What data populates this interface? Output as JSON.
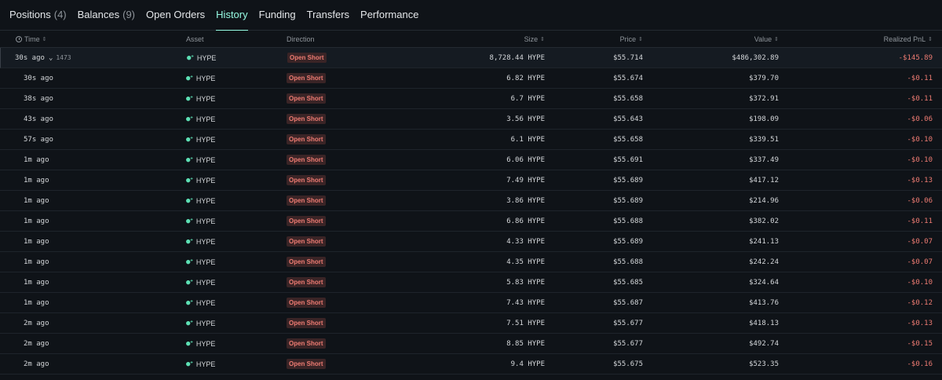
{
  "tabs": [
    {
      "label": "Positions",
      "count": "(4)"
    },
    {
      "label": "Balances",
      "count": "(9)"
    },
    {
      "label": "Open Orders",
      "count": ""
    },
    {
      "label": "History",
      "count": ""
    },
    {
      "label": "Funding",
      "count": ""
    },
    {
      "label": "Transfers",
      "count": ""
    },
    {
      "label": "Performance",
      "count": ""
    }
  ],
  "active_tab": "History",
  "columns": {
    "time": "Time",
    "asset": "Asset",
    "direction": "Direction",
    "size": "Size",
    "price": "Price",
    "value": "Value",
    "pnl": "Realized PnL"
  },
  "colors": {
    "accent": "#97fce4",
    "negative": "#ed7b72",
    "badge_bg": "#3a2426"
  },
  "icons": {
    "asset": "hype-logo-icon",
    "sort": "sort-icon",
    "clock": "clock-icon",
    "expand": "chevron-down-icon"
  },
  "parent_row": {
    "time": "30s ago",
    "child_count": "1473",
    "asset": "HYPE",
    "direction": "Open Short",
    "size": "8,728.44 HYPE",
    "price": "$55.714",
    "value": "$486,302.89",
    "pnl": "-$145.89"
  },
  "rows": [
    {
      "time": "30s ago",
      "asset": "HYPE",
      "direction": "Open Short",
      "size": "6.82 HYPE",
      "price": "$55.674",
      "value": "$379.70",
      "pnl": "-$0.11"
    },
    {
      "time": "38s ago",
      "asset": "HYPE",
      "direction": "Open Short",
      "size": "6.7 HYPE",
      "price": "$55.658",
      "value": "$372.91",
      "pnl": "-$0.11"
    },
    {
      "time": "43s ago",
      "asset": "HYPE",
      "direction": "Open Short",
      "size": "3.56 HYPE",
      "price": "$55.643",
      "value": "$198.09",
      "pnl": "-$0.06"
    },
    {
      "time": "57s ago",
      "asset": "HYPE",
      "direction": "Open Short",
      "size": "6.1 HYPE",
      "price": "$55.658",
      "value": "$339.51",
      "pnl": "-$0.10"
    },
    {
      "time": "1m ago",
      "asset": "HYPE",
      "direction": "Open Short",
      "size": "6.06 HYPE",
      "price": "$55.691",
      "value": "$337.49",
      "pnl": "-$0.10"
    },
    {
      "time": "1m ago",
      "asset": "HYPE",
      "direction": "Open Short",
      "size": "7.49 HYPE",
      "price": "$55.689",
      "value": "$417.12",
      "pnl": "-$0.13"
    },
    {
      "time": "1m ago",
      "asset": "HYPE",
      "direction": "Open Short",
      "size": "3.86 HYPE",
      "price": "$55.689",
      "value": "$214.96",
      "pnl": "-$0.06"
    },
    {
      "time": "1m ago",
      "asset": "HYPE",
      "direction": "Open Short",
      "size": "6.86 HYPE",
      "price": "$55.688",
      "value": "$382.02",
      "pnl": "-$0.11"
    },
    {
      "time": "1m ago",
      "asset": "HYPE",
      "direction": "Open Short",
      "size": "4.33 HYPE",
      "price": "$55.689",
      "value": "$241.13",
      "pnl": "-$0.07"
    },
    {
      "time": "1m ago",
      "asset": "HYPE",
      "direction": "Open Short",
      "size": "4.35 HYPE",
      "price": "$55.688",
      "value": "$242.24",
      "pnl": "-$0.07"
    },
    {
      "time": "1m ago",
      "asset": "HYPE",
      "direction": "Open Short",
      "size": "5.83 HYPE",
      "price": "$55.685",
      "value": "$324.64",
      "pnl": "-$0.10"
    },
    {
      "time": "1m ago",
      "asset": "HYPE",
      "direction": "Open Short",
      "size": "7.43 HYPE",
      "price": "$55.687",
      "value": "$413.76",
      "pnl": "-$0.12"
    },
    {
      "time": "2m ago",
      "asset": "HYPE",
      "direction": "Open Short",
      "size": "7.51 HYPE",
      "price": "$55.677",
      "value": "$418.13",
      "pnl": "-$0.13"
    },
    {
      "time": "2m ago",
      "asset": "HYPE",
      "direction": "Open Short",
      "size": "8.85 HYPE",
      "price": "$55.677",
      "value": "$492.74",
      "pnl": "-$0.15"
    },
    {
      "time": "2m ago",
      "asset": "HYPE",
      "direction": "Open Short",
      "size": "9.4 HYPE",
      "price": "$55.675",
      "value": "$523.35",
      "pnl": "-$0.16"
    }
  ]
}
